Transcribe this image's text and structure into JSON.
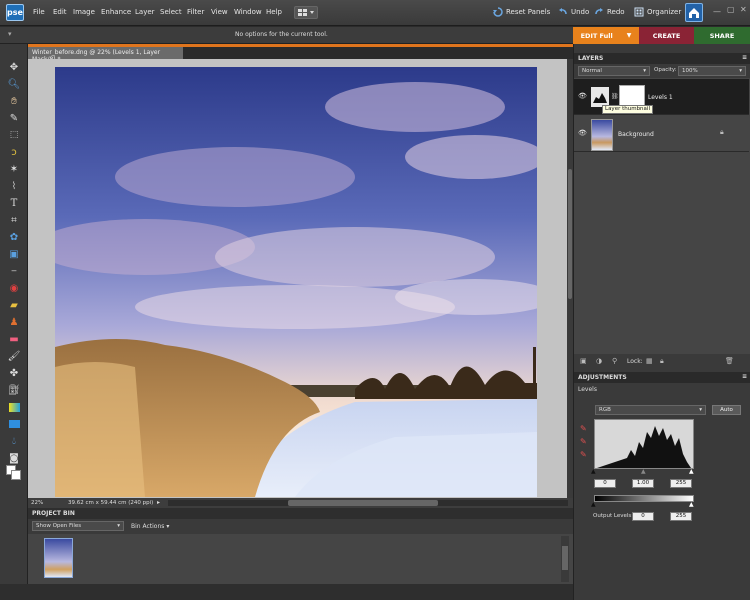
{
  "app": {
    "logo_text": "pse",
    "menu": [
      "File",
      "Edit",
      "Image",
      "Enhance",
      "Layer",
      "Select",
      "Filter",
      "View",
      "Window",
      "Help"
    ],
    "toolbar_buttons": {
      "reset_panels": "Reset Panels",
      "undo": "Undo",
      "redo": "Redo",
      "organizer": "Organizer"
    }
  },
  "options_bar": {
    "message": "No options for the current tool."
  },
  "mode_tabs": [
    {
      "label": "EDIT Full",
      "color": "#e8821c"
    },
    {
      "label": "CREATE",
      "color": "#8a2335"
    },
    {
      "label": "SHARE",
      "color": "#2f6b2f"
    }
  ],
  "document": {
    "tab_title": "Winter_before.dng @ 22% (Levels 1, Layer Mask/8) *",
    "status_zoom": "22%",
    "status_size": "39.62 cm x 59.44 cm (240 ppi)"
  },
  "project_bin": {
    "title": "PROJECT BIN",
    "show_select": "Show Open Files",
    "bin_actions": "Bin Actions"
  },
  "layers_panel": {
    "title": "LAYERS",
    "blend_mode": "Normal",
    "opacity_label": "Opacity:",
    "opacity_value": "100%",
    "lock_label": "Lock:",
    "layers": [
      {
        "name": "Levels 1",
        "tooltip": "Layer thumbnail"
      },
      {
        "name": "Background"
      }
    ]
  },
  "adjustments_panel": {
    "title": "ADJUSTMENTS",
    "section": "Levels",
    "channel": "RGB",
    "auto_button": "Auto",
    "input_levels": [
      "0",
      "1.00",
      "255"
    ],
    "output_label": "Output Levels:",
    "output_levels": [
      "0",
      "255"
    ]
  },
  "colors": {
    "accent_orange": "#e0751d",
    "panel_bg": "#3a3a3a"
  }
}
